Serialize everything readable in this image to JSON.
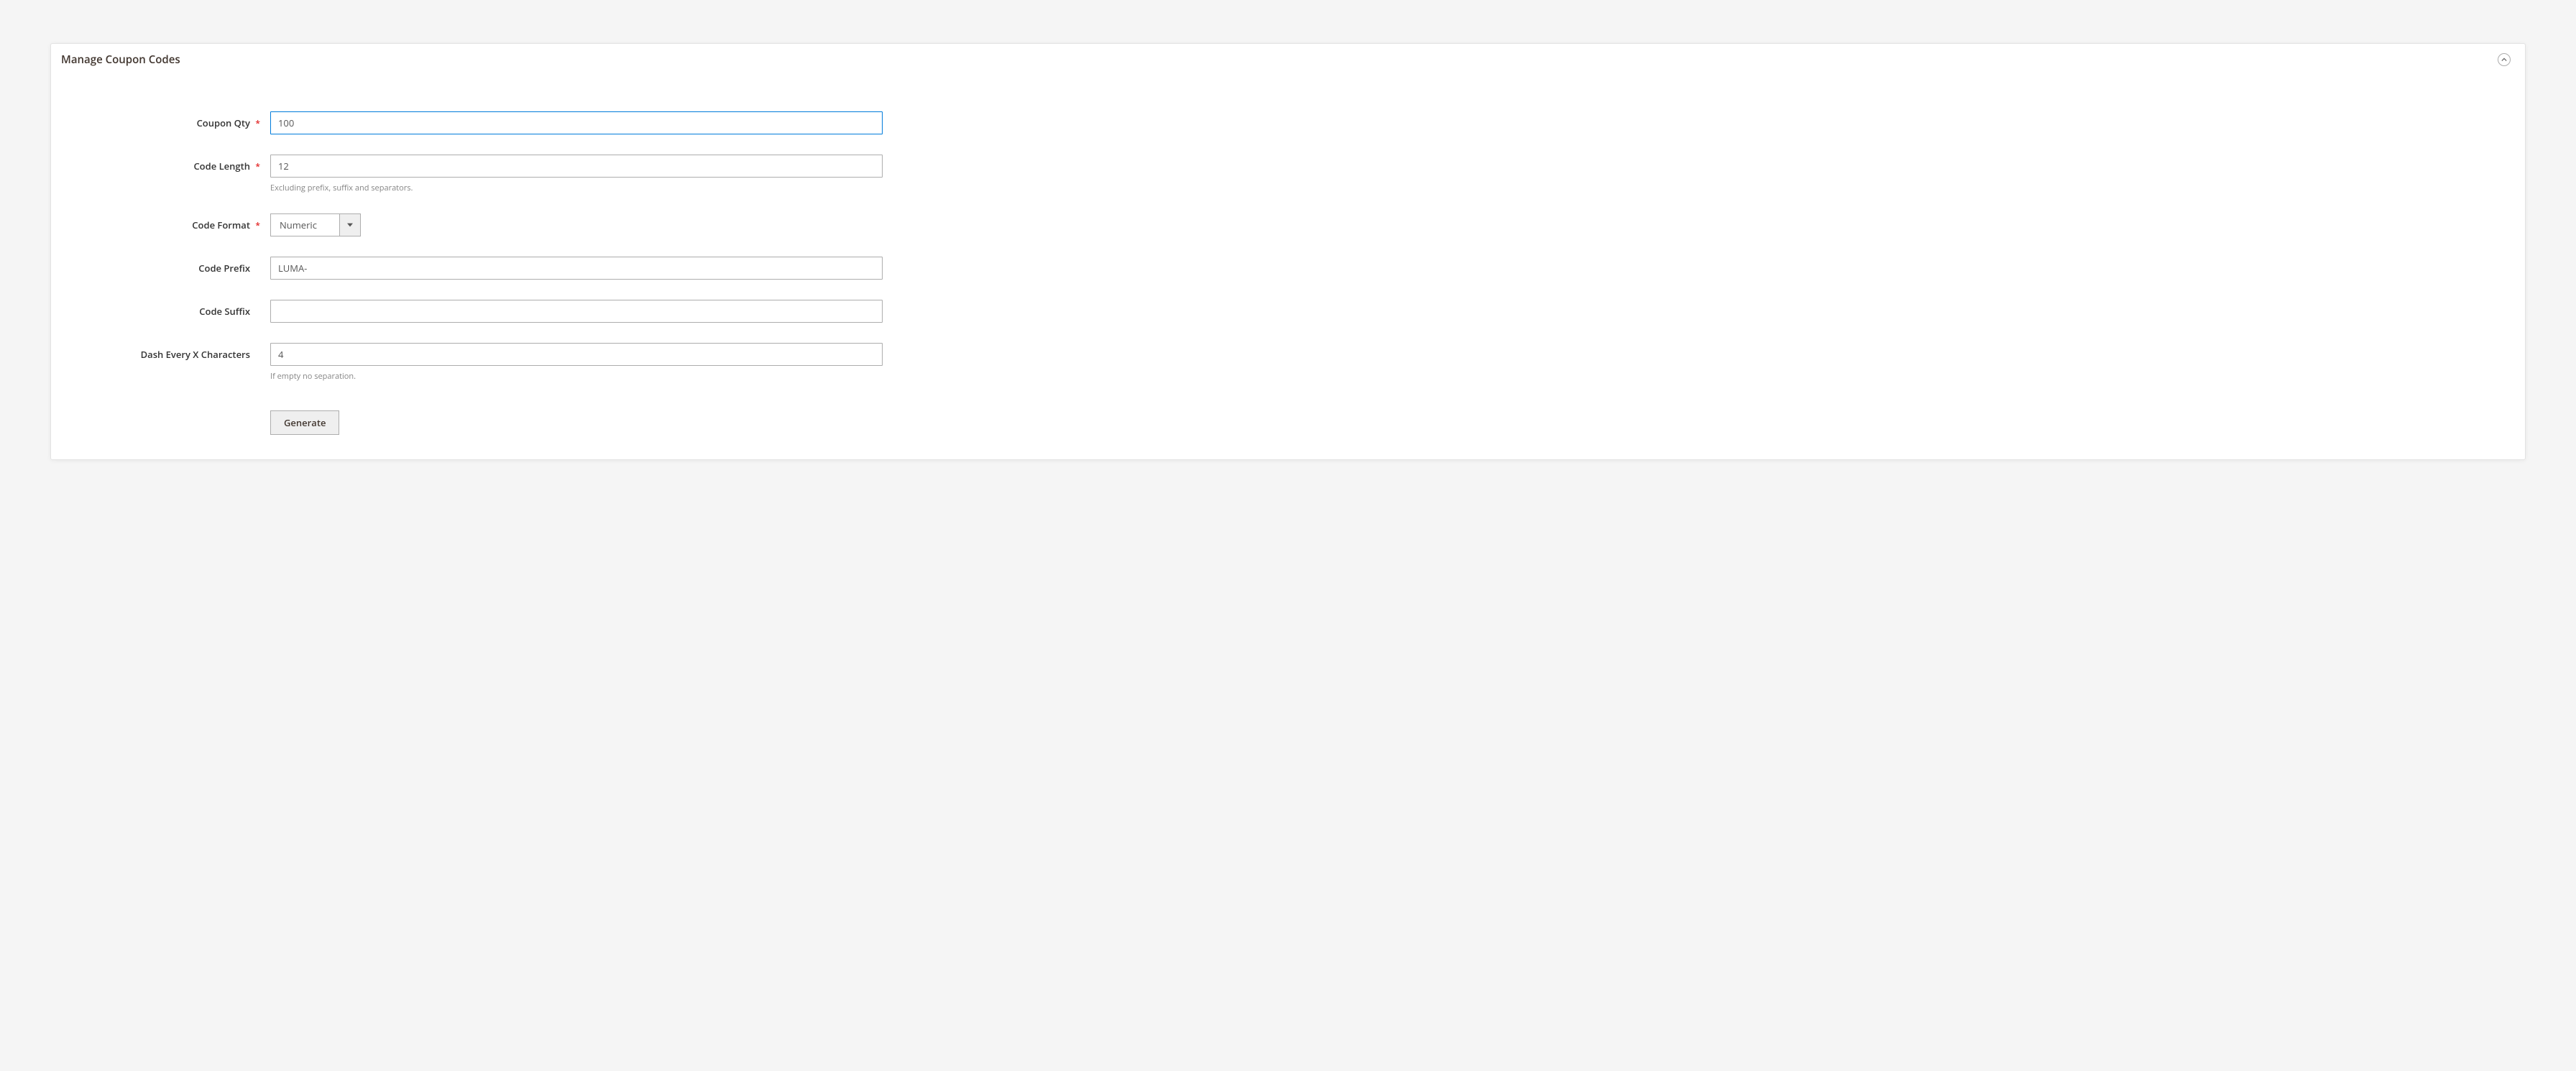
{
  "panel": {
    "title": "Manage Coupon Codes"
  },
  "form": {
    "coupon_qty": {
      "label": "Coupon Qty",
      "value": "100"
    },
    "code_length": {
      "label": "Code Length",
      "value": "12",
      "helper": "Excluding prefix, suffix and separators."
    },
    "code_format": {
      "label": "Code Format",
      "value": "Numeric"
    },
    "code_prefix": {
      "label": "Code Prefix",
      "value": "LUMA-"
    },
    "code_suffix": {
      "label": "Code Suffix",
      "value": ""
    },
    "dash_every": {
      "label": "Dash Every X Characters",
      "value": "4",
      "helper": "If empty no separation."
    },
    "generate_button": "Generate"
  }
}
